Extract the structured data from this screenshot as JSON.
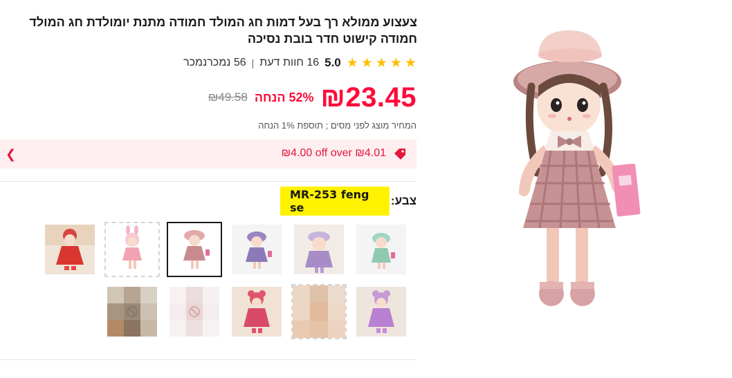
{
  "product": {
    "title": "צעצוע ממולא רך בעל דמות חג המולד חמודה מתנת יומולדת חג המולד חמודה קישוט חדר בובת נסיכה",
    "rating": {
      "score": "5.0",
      "reviews": "16 חוות דעת",
      "separator": "|",
      "sold": "56 נמכרנמכר",
      "stars": 5
    },
    "price": {
      "current": "₪23.45",
      "discount": "52% הנחה",
      "original": "₪49.58"
    },
    "tax_note": "המחיר מוצג לפני מסים ; תוספת 1% הנחה",
    "coupon": {
      "text": "₪4.00 off over ₪4.01",
      "icon": "coupon-tag-icon",
      "chevron": "chevron-left-icon"
    },
    "color": {
      "label": "צבע:",
      "selected_value": "MR-253 feng se"
    },
    "swatches": [
      {
        "name": "swatch-green-hat-doll",
        "theme": "green"
      },
      {
        "name": "swatch-purple-beret-doll",
        "theme": "purple-beret"
      },
      {
        "name": "swatch-purple-plaid-doll",
        "theme": "purple"
      },
      {
        "name": "swatch-pink-plaid-doll",
        "theme": "pink-selected"
      },
      {
        "name": "swatch-pink-bunny-doll",
        "theme": "pink-bunny"
      },
      {
        "name": "swatch-red-dress-doll",
        "theme": "red"
      },
      {
        "name": "swatch-purple-bear-doll",
        "theme": "purple-bear"
      },
      {
        "name": "swatch-blurred-unavailable-1",
        "theme": "blur-peach"
      },
      {
        "name": "swatch-red-bear-doll",
        "theme": "red-bear"
      },
      {
        "name": "swatch-blurred-unavailable-2",
        "theme": "blur-pale"
      },
      {
        "name": "swatch-blurred-unavailable-3",
        "theme": "blur-brown"
      }
    ],
    "colors": {
      "accent": "#ff0a3a",
      "coupon_bg": "#ffeef0",
      "star": "#fdc000",
      "highlight": "#fff200"
    }
  }
}
